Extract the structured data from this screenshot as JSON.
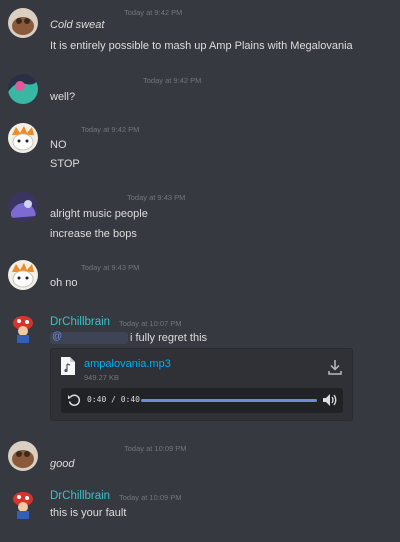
{
  "messages": [
    {
      "id": "m1",
      "timestamp": "Today at 9:42 PM",
      "lines": [
        "Cold sweat",
        "It is entirely possible to mash up Amp Plains with Megalovania"
      ]
    },
    {
      "id": "m2",
      "timestamp": "Today at 9:42 PM",
      "lines": [
        "well?"
      ]
    },
    {
      "id": "m3",
      "timestamp": "Today at 9:42 PM",
      "lines": [
        "NO",
        "STOP"
      ]
    },
    {
      "id": "m4",
      "timestamp": "Today at 9:43 PM",
      "lines": [
        "alright music people",
        "increase the bops"
      ]
    },
    {
      "id": "m5",
      "timestamp": "Today at 9:43 PM",
      "lines": [
        "oh no"
      ]
    },
    {
      "id": "m6",
      "author": "DrChillbrain",
      "timestamp": "Today at 10:07 PM",
      "lines": [
        "i fully regret this"
      ],
      "attachment": {
        "filename": "ampalovania.mp3",
        "size": "949.27 KB",
        "time": "0:40 / 0:40",
        "progress": 1.0
      }
    },
    {
      "id": "m7",
      "timestamp": "Today at 10:09 PM",
      "lines": [
        "good"
      ]
    },
    {
      "id": "m8",
      "author": "DrChillbrain",
      "timestamp": "Today at 10:09 PM",
      "lines": [
        "this is your fault"
      ]
    }
  ],
  "colors": {
    "background": "#36393f",
    "username": "#3ac1c9",
    "link": "#00b0f4",
    "progress": "#7289da"
  },
  "icons": {
    "file": "audio-file-icon",
    "download": "download-icon",
    "replay": "replay-icon",
    "volume": "volume-icon"
  }
}
